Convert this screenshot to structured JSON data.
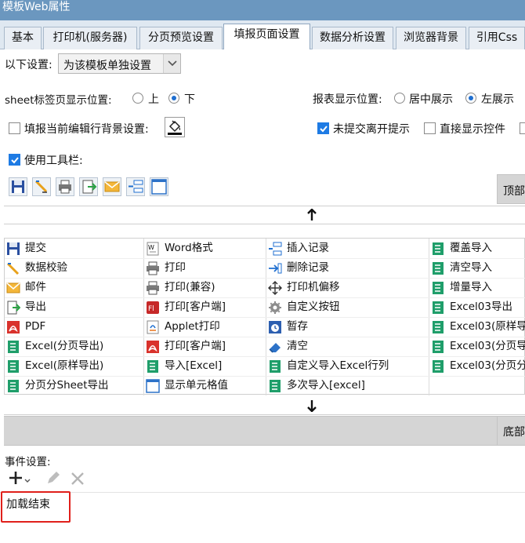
{
  "window": {
    "title": "模板Web属性"
  },
  "tabs": [
    {
      "label": "基本",
      "active": false
    },
    {
      "label": "打印机(服务器)",
      "active": false
    },
    {
      "label": "分页预览设置",
      "active": false
    },
    {
      "label": "填报页面设置",
      "active": true
    },
    {
      "label": "数据分析设置",
      "active": false
    },
    {
      "label": "浏览器背景",
      "active": false
    },
    {
      "label": "引用Css",
      "active": false
    }
  ],
  "settings": {
    "following_label": "以下设置:",
    "scope_value": "为该模板单独设置",
    "sheet_tab_label": "sheet标签页显示位置:",
    "sheet_tab_top": "上",
    "sheet_tab_bottom": "下",
    "report_pos_label": "报表显示位置:",
    "report_center": "居中展示",
    "report_left": "左展示",
    "highlight_row_label": "填报当前编辑行背景设置:",
    "unsubmitted_label": "未提交离开提示",
    "direct_show_label": "直接显示控件",
    "use_toolbar_label": "使用工具栏:"
  },
  "toolbar_area": {
    "top_label": "顶部",
    "bottom_label": "底部"
  },
  "toolbar_icons": [
    "save-icon",
    "verify-icon",
    "print-icon",
    "export-icon",
    "email-icon",
    "insert-row-icon",
    "cell-value-icon"
  ],
  "buttons": [
    [
      "提交",
      "数据校验",
      "邮件",
      "导出",
      "PDF",
      "Excel(分页导出)",
      "Excel(原样导出)",
      "分页分Sheet导出"
    ],
    [
      "Word格式",
      "打印",
      "打印(兼容)",
      "打印[客户端]",
      "Applet打印",
      "打印[客户端]",
      "导入[Excel]",
      "显示单元格值"
    ],
    [
      "插入记录",
      "删除记录",
      "打印机偏移",
      "自定义按钮",
      "暂存",
      "清空",
      "自定义导入Excel行列",
      "多次导入[excel]"
    ],
    [
      "覆盖导入",
      "清空导入",
      "增量导入",
      "Excel03导出",
      "Excel03(原样导",
      "Excel03(分页导",
      "Excel03(分页分",
      ""
    ]
  ],
  "button_icons": [
    [
      "save-icon",
      "verify-icon",
      "email-icon",
      "export-icon",
      "pdf-icon",
      "excel-icon",
      "excel-icon",
      "excel-icon"
    ],
    [
      "word-icon",
      "print-icon",
      "print-icon",
      "flash-print-icon",
      "applet-icon",
      "pdf-icon",
      "excel-icon",
      "cell-value-icon"
    ],
    [
      "insert-row-icon",
      "delete-row-icon",
      "move-icon",
      "gear-icon",
      "clock-save-icon",
      "eraser-icon",
      "excel-icon",
      "excel-icon"
    ],
    [
      "excel-icon",
      "excel-icon",
      "excel-icon",
      "excel-icon",
      "excel-icon",
      "excel-icon",
      "excel-icon",
      ""
    ]
  ],
  "events": {
    "label": "事件设置:",
    "list_item": "加载结束"
  },
  "colors": {
    "titlebar": "#6b97bf",
    "accent": "#1e7be4",
    "highlight_box": "#e0201b"
  }
}
